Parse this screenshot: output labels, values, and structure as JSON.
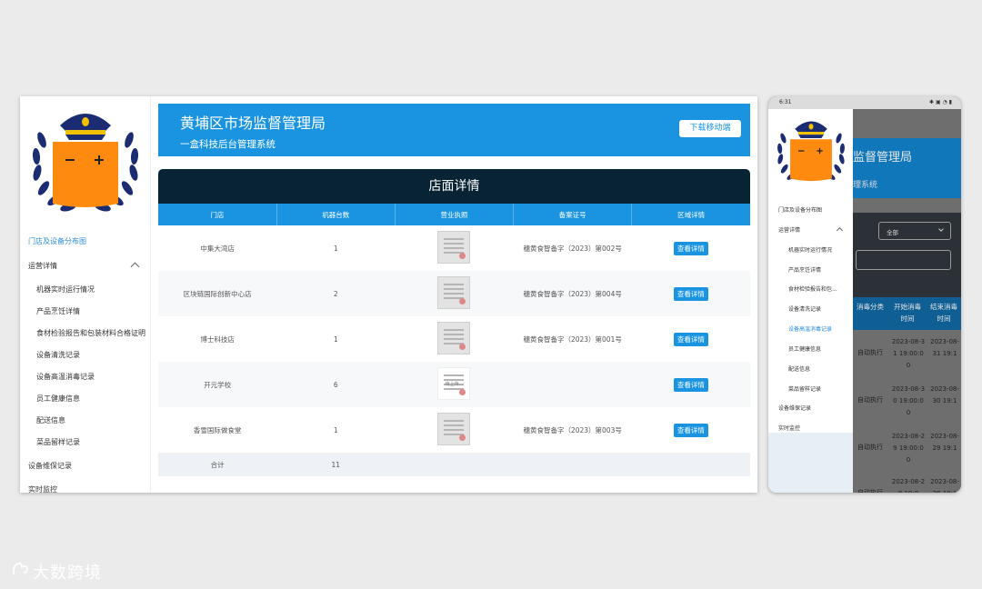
{
  "desktop": {
    "header": {
      "title": "黄埔区市场监督管理局",
      "subtitle": "一盒科技后台管理系统",
      "download_button": "下载移动端"
    },
    "sidebar": {
      "items": [
        {
          "label": "门店及设备分布图",
          "active": true
        },
        {
          "label": "运营详情",
          "expanded": true
        },
        {
          "label": "机器实时运行情况"
        },
        {
          "label": "产品烹饪详情"
        },
        {
          "label": "食材检验报告和包装材料合格证明"
        },
        {
          "label": "设备清洗记录"
        },
        {
          "label": "设备高温消毒记录"
        },
        {
          "label": "员工健康信息"
        },
        {
          "label": "配送信息"
        },
        {
          "label": "菜品留样记录"
        },
        {
          "label": "设备维保记录"
        },
        {
          "label": "实时监控"
        }
      ]
    },
    "detail_title": "店面详情",
    "table": {
      "columns": [
        "门店",
        "机器台数",
        "营业执照",
        "备案证号",
        "区域详情"
      ],
      "rows": [
        {
          "store": "中集大湾店",
          "machines": "1",
          "license": "image",
          "record": "穗黄食智备字（2023）第002号",
          "action": "查看详情"
        },
        {
          "store": "区块链国际创新中心店",
          "machines": "2",
          "license": "image",
          "record": "穗黄食智备字（2023）第004号",
          "action": "查看详情"
        },
        {
          "store": "博士科技店",
          "machines": "1",
          "license": "image",
          "record": "穗黄食智备字（2023）第001号",
          "action": "查看详情"
        },
        {
          "store": "开元学校",
          "machines": "6",
          "license": "uploading",
          "license_text": "待上传...",
          "record": "",
          "action": "查看详情"
        },
        {
          "store": "香雪国际做食堂",
          "machines": "1",
          "license": "image",
          "record": "穗黄食智备字（2023）第003号",
          "action": "查看详情"
        }
      ],
      "total": {
        "label": "合计",
        "machines": "11"
      }
    },
    "colors": {
      "header_blue": "#1a94e0",
      "title_bar": "#082334",
      "accent": "#2b8bd8"
    }
  },
  "phone": {
    "status_time": "6:31",
    "status_icons": "✱ ▣ ◔ ▮",
    "title": "监督管理局",
    "subtitle": "理系统",
    "select_value": "全部",
    "table_headers": [
      "消毒分类",
      "开始消毒时间",
      "结束消毒时间"
    ],
    "rows": [
      {
        "type": "自动执行",
        "start": "2023-08-31 19:00:00",
        "end": "2023-08-31 19:1"
      },
      {
        "type": "自动执行",
        "start": "2023-08-30 19:00:00",
        "end": "2023-08-30 19:1"
      },
      {
        "type": "自动执行",
        "start": "2023-08-29 19:00:00",
        "end": "2023-08-29 19:1"
      },
      {
        "type": "自动执行",
        "start": "2023-08-28 19:0",
        "end": "2023-08-28 19:1"
      }
    ],
    "drawer_items": [
      {
        "label": "门店及设备分布图"
      },
      {
        "label": "运营详情"
      },
      {
        "label": "机器实时运行情况"
      },
      {
        "label": "产品烹饪详情"
      },
      {
        "label": "食材检验报告和包..."
      },
      {
        "label": "设备清洗记录"
      },
      {
        "label": "设备高温消毒记录",
        "active": true
      },
      {
        "label": "员工健康信息"
      },
      {
        "label": "配送信息"
      },
      {
        "label": "菜品留样记录"
      },
      {
        "label": "设备维保记录"
      },
      {
        "label": "实时监控"
      }
    ]
  },
  "watermark": "大数跨境"
}
